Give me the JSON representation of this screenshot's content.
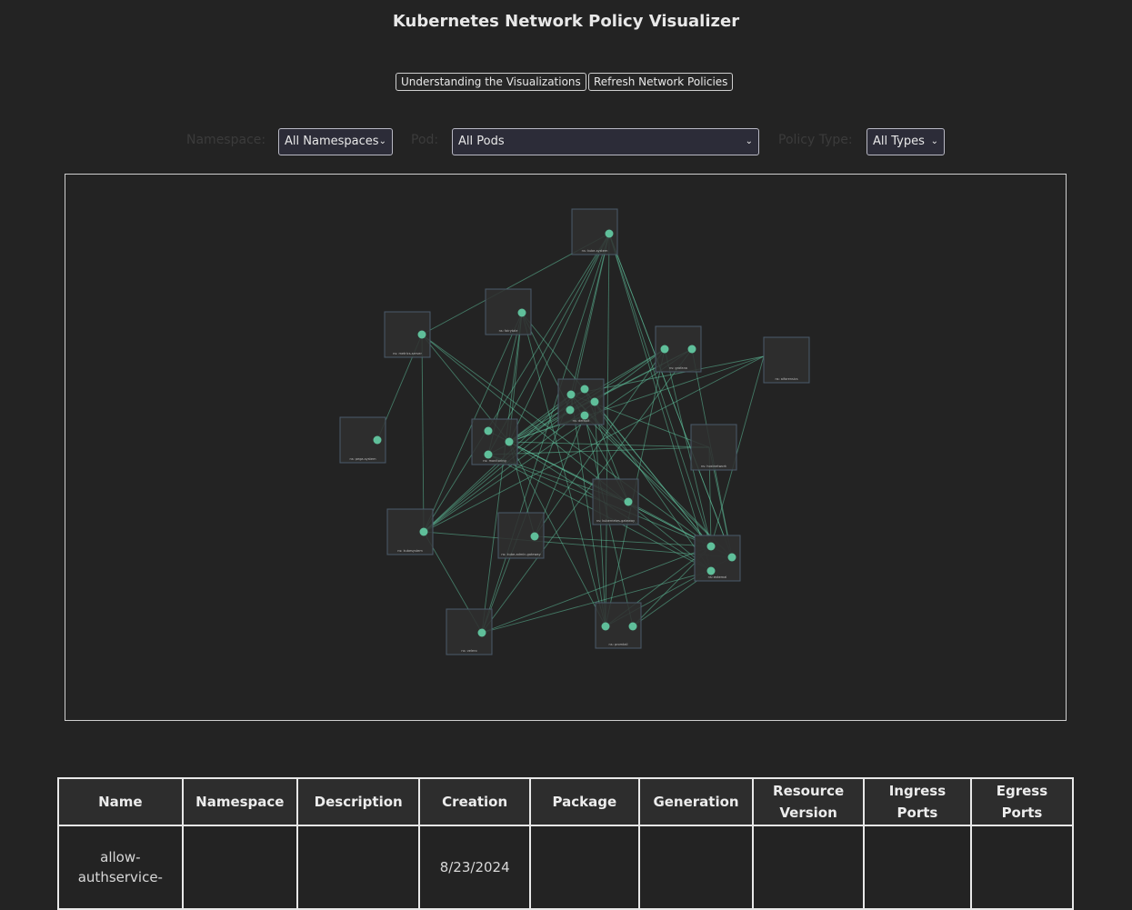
{
  "app": {
    "title": "Kubernetes Network Policy Visualizer"
  },
  "toolbar": {
    "understanding_label": "Understanding the Visualizations",
    "refresh_label": "Refresh Network Policies"
  },
  "filters": {
    "namespace": {
      "label": "Namespace:",
      "value": "All Namespaces"
    },
    "pod": {
      "label": "Pod:",
      "value": "All Pods"
    },
    "policy_type": {
      "label": "Policy Type:",
      "value": "All Types"
    }
  },
  "graph": {
    "colors": {
      "node": "#5fbf9a",
      "edge": "#5fbf9a",
      "group_fill": "#2f2f2f",
      "group_stroke": "#4a5a6a"
    },
    "groups": [
      {
        "name": "ns: kube-system"
      },
      {
        "name": "ns: fairytale"
      },
      {
        "name": "ns: metrics-server"
      },
      {
        "name": "ns: grafana"
      },
      {
        "name": "ns: aiforensics"
      },
      {
        "name": "ns: pega-system"
      },
      {
        "name": "ns: default"
      },
      {
        "name": "ns: monitoring"
      },
      {
        "name": "ns: hostnetwork"
      },
      {
        "name": "ns: kubernetes-gateway"
      },
      {
        "name": "ns: kubesystem"
      },
      {
        "name": "ns: kube-admin-gateway"
      },
      {
        "name": "ns: istio"
      },
      {
        "name": "ns: velero"
      },
      {
        "name": "ns: promtail"
      },
      {
        "name": "ns: external"
      }
    ]
  },
  "table": {
    "headers": [
      "Name",
      "Namespace",
      "Description",
      "Creation",
      "Package",
      "Generation",
      "Resource Version",
      "Ingress Ports",
      "Egress Ports"
    ],
    "rows": [
      [
        "allow-authservice-",
        "",
        "",
        "8/23/2024",
        "",
        "",
        "",
        "",
        ""
      ]
    ]
  }
}
